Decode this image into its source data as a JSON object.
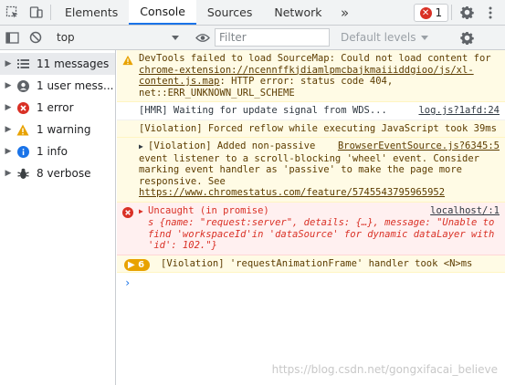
{
  "tabs": [
    "Elements",
    "Console",
    "Sources",
    "Network"
  ],
  "tab_more": "»",
  "error_count": "1",
  "toolbar": {
    "context": "top",
    "filter_placeholder": "Filter",
    "levels": "Default levels"
  },
  "sidebar": {
    "items": [
      {
        "label": "11 messages",
        "icon": "list-icon"
      },
      {
        "label": "1 user mess...",
        "icon": "user-icon"
      },
      {
        "label": "1 error",
        "icon": "error-icon"
      },
      {
        "label": "1 warning",
        "icon": "warning-icon"
      },
      {
        "label": "1 info",
        "icon": "info-icon"
      },
      {
        "label": "8 verbose",
        "icon": "bug-icon"
      }
    ]
  },
  "messages": {
    "m1": {
      "pre": "DevTools failed to load SourceMap: Could not load content for ",
      "link": "chrome-extension://ncennffkjdiamlpmcbajkmaiiiddgioo/js/xl-content.js.map",
      "post": ": HTTP error: status code 404, net::ERR_UNKNOWN_URL_SCHEME"
    },
    "m2": {
      "text": "[HMR] Waiting for update signal from WDS...",
      "source": "log.js?1afd:24"
    },
    "m3": {
      "text": "[Violation] Forced reflow while executing JavaScript took 39ms"
    },
    "m4": {
      "text": "[Violation] Added non-passive event listener to a scroll-blocking 'wheel' event. Consider marking event handler as 'passive' to make the page more responsive. See ",
      "link": "https://www.chromestatus.com/feature/5745543795965952",
      "source": "BrowserEventSource.js?6345:5"
    },
    "m5": {
      "head": "Uncaught (in promise)",
      "body": "s {name: \"request:server\", details: {…}, message: \"Unable to find 'workspaceId'in 'dataSource' for dynamic dataLayer with 'id': 102.\"}",
      "source": "localhost/:1"
    },
    "m6": {
      "badge": "6",
      "text": "[Violation] 'requestAnimationFrame' handler took <N>ms"
    }
  },
  "prompt": "›",
  "watermark": "https://blog.csdn.net/gongxifacai_believe",
  "colors": {
    "accent": "#1a73e8",
    "error": "#d93025",
    "warning": "#e8a200"
  }
}
